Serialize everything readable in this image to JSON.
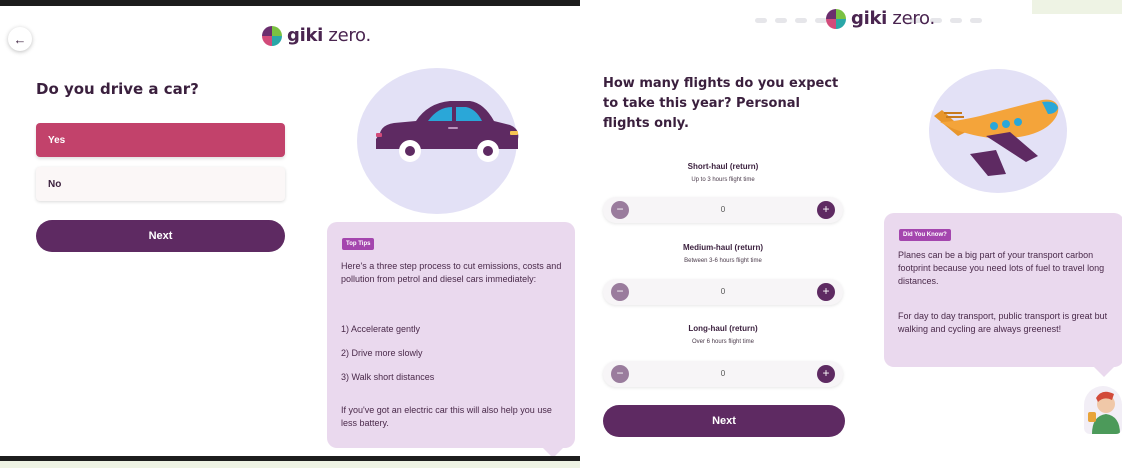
{
  "left_screen": {
    "back_icon": "arrow-left-icon",
    "logo": {
      "brand": "giki",
      "suffix": " zero."
    },
    "question": "Do you drive a car?",
    "options": [
      {
        "label": "Yes",
        "selected": true
      },
      {
        "label": "No",
        "selected": false
      }
    ],
    "next_label": "Next",
    "illustration": "car-icon",
    "tips": {
      "badge": "Top Tips",
      "intro": "Here's a three step process to cut emissions, costs and pollution from petrol and diesel cars immediately:",
      "steps": [
        "1) Accelerate gently",
        "2) Drive more slowly",
        "3) Walk short distances"
      ],
      "outro": "If you've got an electric car this will also help you use less battery."
    }
  },
  "right_screen": {
    "logo": {
      "brand": "giki",
      "suffix": " zero."
    },
    "question_lines": [
      "How many flights do you expect",
      "to take this year? Personal",
      "flights only."
    ],
    "flights": [
      {
        "label": "Short-haul (return)",
        "sub": "Up to 3 hours flight time",
        "value": "0"
      },
      {
        "label": "Medium-haul (return)",
        "sub": "Between 3-6 hours flight time",
        "value": "0"
      },
      {
        "label": "Long-haul (return)",
        "sub": "Over 6 hours flight time",
        "value": "0"
      }
    ],
    "minus_symbol": "−",
    "plus_symbol": "+",
    "next_label": "Next",
    "illustration": "airplane-icon",
    "did_you_know": {
      "badge": "Did You Know?",
      "p1": "Planes can be a big part of your transport carbon footprint because you need lots of fuel to travel long distances.",
      "p2": "For day to day transport, public transport is great but walking and cycling are always greenest!"
    },
    "avatar": "mascot-avatar"
  },
  "colors": {
    "primary": "#5e2a62",
    "selected": "#c2426b",
    "card": "#ead9ee",
    "badge": "#a446ae",
    "blob": "#e3e1f6"
  }
}
